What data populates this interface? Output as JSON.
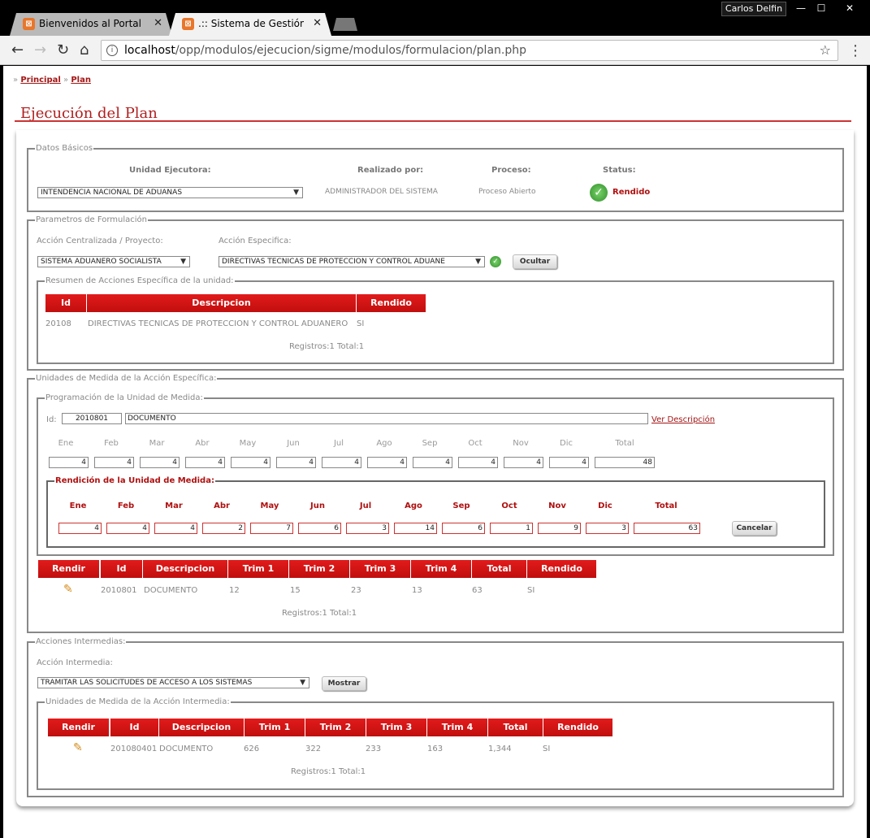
{
  "browser": {
    "tabs": [
      {
        "title": "Bienvenidos al Portal de"
      },
      {
        "title": ".:: Sistema de Gestión de"
      }
    ],
    "user": "Carlos Delfin",
    "url_host": "localhost",
    "url_path": "/opp/modulos/ejecucion/sigme/modulos/formulacion/plan.php"
  },
  "breadcrumb": {
    "home": "Principal",
    "current": "Plan",
    "sep": "»"
  },
  "page_title": "Ejecución del Plan",
  "datos_basicos": {
    "legend": "Datos Básicos",
    "unidad_label": "Unidad Ejecutora:",
    "unidad_value": "INTENDENCIA NACIONAL DE ADUANAS",
    "realizado_label": "Realizado por:",
    "realizado_value": "ADMINISTRADOR DEL SISTEMA",
    "proceso_label": "Proceso:",
    "proceso_value": "Proceso Abierto",
    "status_label": "Status:",
    "status_value": "Rendido"
  },
  "parametros": {
    "legend": "Parametros de Formulación",
    "accion_label": "Acción Centralizada / Proyecto:",
    "accion_value": "SISTEMA ADUANERO SOCIALISTA",
    "especifica_label": "Acción Especifica:",
    "especifica_value": "DIRECTIVAS TECNICAS DE PROTECCION Y CONTROL ADUANE",
    "ocultar": "Ocultar",
    "resumen": {
      "legend": "Resumen de Acciones Específica de la unidad:",
      "headers": [
        "Id",
        "Descripcion",
        "Rendido"
      ],
      "rows": [
        {
          "id": "20108",
          "desc": "DIRECTIVAS TECNICAS DE PROTECCION Y CONTROL ADUANERO",
          "rendido": "SI"
        }
      ],
      "footer": "Registros:1 Total:1"
    }
  },
  "unidades_medida": {
    "legend": "Unidades de Medida de la Acción Específica:",
    "programacion": {
      "legend": "Programación de la Unidad de Medida:",
      "id_label": "Id:",
      "id_value": "2010801",
      "desc_value": "DOCUMENTO",
      "ver_link": "Ver Descripción",
      "months": [
        "Ene",
        "Feb",
        "Mar",
        "Abr",
        "May",
        "Jun",
        "Jul",
        "Ago",
        "Sep",
        "Oct",
        "Nov",
        "Dic",
        "Total"
      ],
      "values": [
        "4",
        "4",
        "4",
        "4",
        "4",
        "4",
        "4",
        "4",
        "4",
        "4",
        "4",
        "4",
        "48"
      ]
    },
    "rendicion": {
      "legend": "Rendición de la Unidad de Medida:",
      "months": [
        "Ene",
        "Feb",
        "Mar",
        "Abr",
        "May",
        "Jun",
        "Jul",
        "Ago",
        "Sep",
        "Oct",
        "Nov",
        "Dic",
        "Total"
      ],
      "values": [
        "4",
        "4",
        "4",
        "2",
        "7",
        "6",
        "3",
        "14",
        "6",
        "1",
        "9",
        "3",
        "63"
      ],
      "cancelar": "Cancelar"
    },
    "table": {
      "headers": [
        "Rendir",
        "Id",
        "Descripcion",
        "Trim 1",
        "Trim 2",
        "Trim 3",
        "Trim 4",
        "Total",
        "Rendido"
      ],
      "rows": [
        {
          "id": "2010801",
          "desc": "DOCUMENTO",
          "t1": "12",
          "t2": "15",
          "t3": "23",
          "t4": "13",
          "total": "63",
          "rendido": "SI"
        }
      ],
      "footer": "Registros:1 Total:1"
    }
  },
  "acciones_intermedias": {
    "legend": "Acciones Intermedias:",
    "accion_label": "Acción Intermedia:",
    "accion_value": "TRAMITAR LAS SOLICITUDES DE ACCESO A LOS SISTEMAS",
    "mostrar": "Mostrar",
    "sub": {
      "legend": "Unidades de Medida de la Acción Intermedia:",
      "headers": [
        "Rendir",
        "Id",
        "Descripcion",
        "Trim 1",
        "Trim 2",
        "Trim 3",
        "Trim 4",
        "Total",
        "Rendido"
      ],
      "rows": [
        {
          "id": "201080401",
          "desc": "DOCUMENTO",
          "t1": "626",
          "t2": "322",
          "t3": "233",
          "t4": "163",
          "total": "1,344",
          "rendido": "SI"
        }
      ],
      "footer": "Registros:1 Total:1"
    }
  }
}
